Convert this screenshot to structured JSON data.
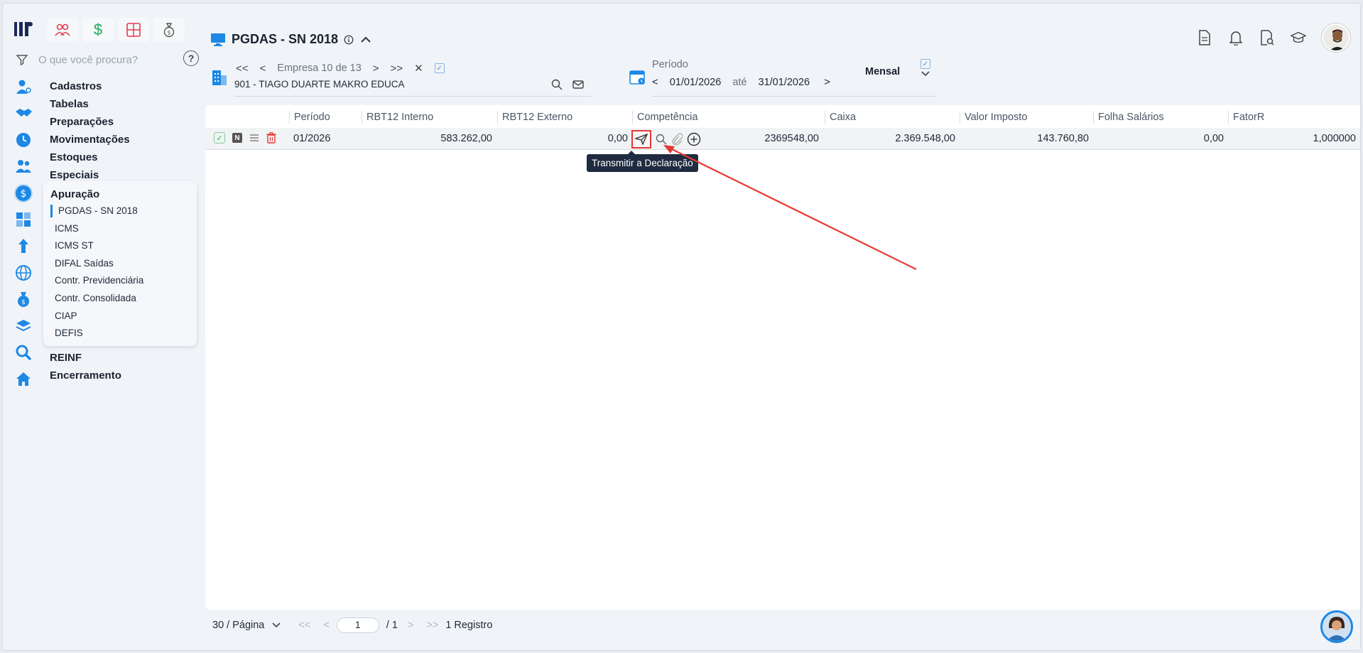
{
  "sidebar": {
    "search_placeholder": "O que você procura?",
    "help_symbol": "?",
    "nav_top": [
      "Cadastros",
      "Tabelas",
      "Preparações",
      "Movimentações",
      "Estoques",
      "Especiais"
    ],
    "submenu": {
      "title": "Apuração",
      "items": [
        "PGDAS - SN 2018",
        "ICMS",
        "ICMS ST",
        "DIFAL Saídas",
        "Contr. Previdenciária",
        "Contr. Consolidada",
        "CIAP",
        "DEFIS"
      ]
    },
    "nav_bottom": [
      "REINF",
      "Encerramento"
    ]
  },
  "header": {
    "title": "PGDAS - SN 2018"
  },
  "empresa": {
    "nav_first": "<<",
    "nav_prev": "<",
    "label": "Empresa 10 de 13",
    "nav_next": ">",
    "nav_last": ">>",
    "clear": "✕",
    "name": "901 - TIAGO DUARTE MAKRO EDUCA"
  },
  "periodo": {
    "label": "Período",
    "start": "01/01/2026",
    "separator": "até",
    "end": "31/01/2026",
    "mode": "Mensal"
  },
  "grid": {
    "columns": [
      "Período",
      "RBT12 Interno",
      "RBT12 Externo",
      "Competência",
      "Caixa",
      "Valor Imposto",
      "Folha Salários",
      "FatorR"
    ],
    "row": {
      "badge": "N",
      "periodo": "01/2026",
      "rbt12_interno": "583.262,00",
      "rbt12_externo": "0,00",
      "competencia": "2369548,00",
      "caixa": "2.369.548,00",
      "valor_imposto": "143.760,80",
      "folha_salarios": "0,00",
      "fator_r": "1,000000"
    },
    "tooltip": "Transmitir a Declaração"
  },
  "pagination": {
    "per_page": "30 / Página",
    "first": "<<",
    "prev": "<",
    "page": "1",
    "total": "/ 1",
    "next": ">",
    "last": ">>",
    "records": "1 Registro"
  },
  "colors": {
    "accent": "#1e88e5",
    "highlight": "#e53935",
    "tooltip_bg": "#1f2b40"
  }
}
